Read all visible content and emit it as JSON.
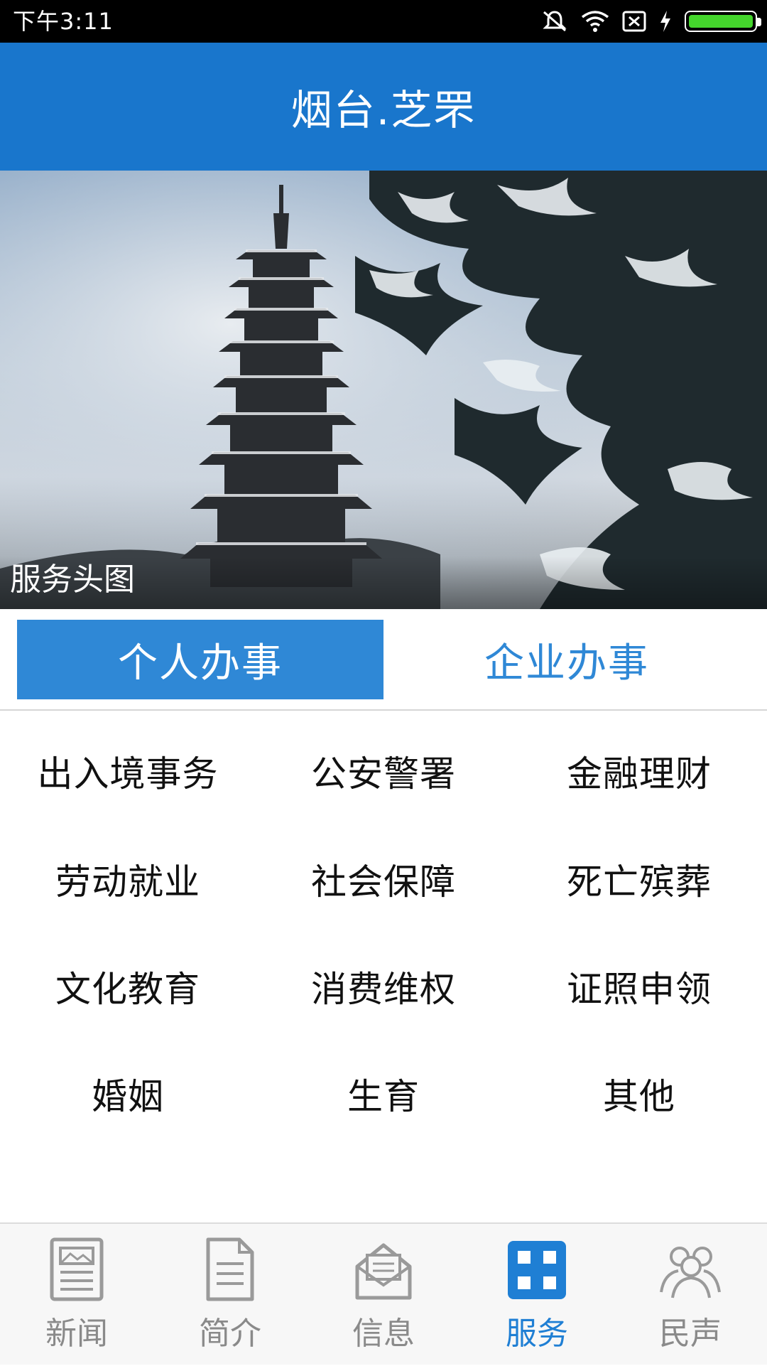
{
  "status_bar": {
    "time": "下午3:11"
  },
  "app_bar": {
    "title": "烟台.芝罘"
  },
  "banner": {
    "caption": "服务头图"
  },
  "tabs": [
    {
      "label": "个人办事",
      "active": true
    },
    {
      "label": "企业办事",
      "active": false
    }
  ],
  "services": [
    [
      "出入境事务",
      "公安警署",
      "金融理财"
    ],
    [
      "劳动就业",
      "社会保障",
      "死亡殡葬"
    ],
    [
      "文化教育",
      "消费维权",
      "证照申领"
    ],
    [
      "婚姻",
      "生育",
      "其他"
    ]
  ],
  "bottom_nav": [
    {
      "label": "新闻",
      "icon": "news-icon",
      "active": false
    },
    {
      "label": "简介",
      "icon": "document-icon",
      "active": false
    },
    {
      "label": "信息",
      "icon": "mail-icon",
      "active": false
    },
    {
      "label": "服务",
      "icon": "grid-icon",
      "active": true
    },
    {
      "label": "民声",
      "icon": "people-icon",
      "active": false
    }
  ],
  "colors": {
    "app_bar": "#1976cc",
    "accent": "#2f88d6",
    "nav_active": "#1f7fd4",
    "nav_inactive": "#8a8a8a"
  }
}
